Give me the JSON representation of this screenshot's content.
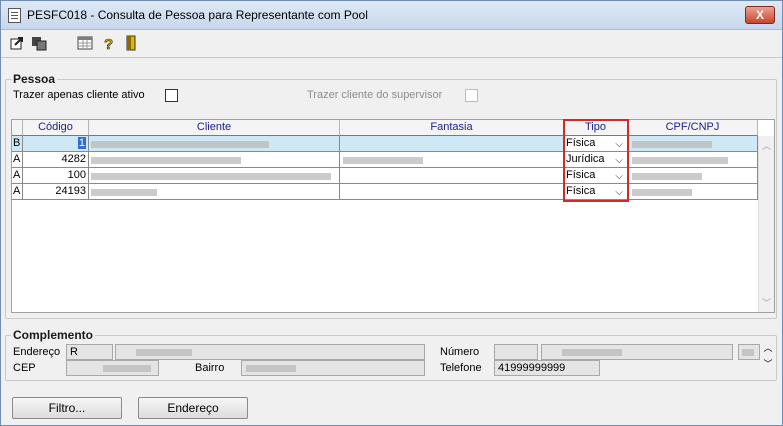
{
  "window": {
    "title": "PESFC018 - Consulta de Pessoa para Representante com Pool",
    "close_label": "X"
  },
  "toolbar": {
    "icons": [
      "export-icon",
      "copy-icon",
      "grid-icon",
      "help-icon",
      "exit-icon"
    ]
  },
  "pessoa": {
    "legend": "Pessoa",
    "cliente_ativo_label": "Trazer apenas cliente ativo",
    "supervisor_label": "Trazer cliente do supervisor"
  },
  "grid": {
    "columns": [
      "Código",
      "Cliente",
      "Fantasia",
      "Tipo",
      "CPF/CNPJ"
    ],
    "rows": [
      {
        "status": "B",
        "codigo": "1",
        "tipo": "Física"
      },
      {
        "status": "A",
        "codigo": "4282",
        "tipo": "Jurídica"
      },
      {
        "status": "A",
        "codigo": "100",
        "tipo": "Física"
      },
      {
        "status": "A",
        "codigo": "24193",
        "tipo": "Física"
      }
    ]
  },
  "complemento": {
    "legend": "Complemento",
    "endereco_label": "Endereço",
    "endereco_tipo": "R",
    "numero_label": "Número",
    "cep_label": "CEP",
    "bairro_label": "Bairro",
    "telefone_label": "Telefone",
    "telefone_value": "41999999999"
  },
  "buttons": {
    "filtro": "Filtro...",
    "endereco": "Endereço"
  }
}
